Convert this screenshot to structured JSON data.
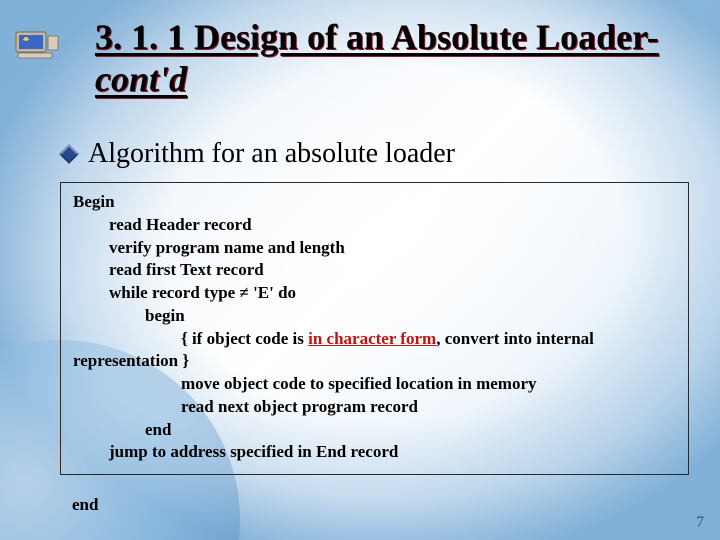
{
  "title_main": "3. 1. 1 Design of an Absolute Loader",
  "title_suffix_plain": "-",
  "title_suffix_italic": "cont'd",
  "subhead": "Algorithm for an absolute loader",
  "algo": {
    "l0": "Begin",
    "l1": "read Header record",
    "l2": "verify program name and length",
    "l3": "read first Text record",
    "l4_a": "while record type ",
    "l4_ne": "≠",
    "l4_b": " 'E' do",
    "l5": "begin",
    "l6_a": "{ if object code is ",
    "l6_red": "in character form",
    "l6_b": ", convert into internal",
    "l7": "representation }",
    "l8": "move object code to specified location in memory",
    "l9": "read next object program record",
    "l10": "end",
    "l11": "jump to address specified in End record"
  },
  "end_word": "end",
  "page_number": "7",
  "chart_data": null
}
